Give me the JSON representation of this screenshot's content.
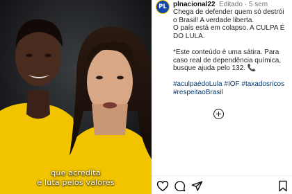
{
  "post": {
    "avatar_text": "PL",
    "username": "plnacional22",
    "edited": "Editado",
    "separator": "·",
    "age": "5 sem",
    "caption_line1": "Chega de defender quem só destrói o Brasil! A verdade liberta.",
    "caption_line2": "O país está em colapso. A CULPA É DO LULA.",
    "caption_line3": "*Este conteúdo é uma sátira. Para caso real de dependência química, busque ajuda pelo 132.",
    "phone_emoji": "📞",
    "hashtags": "#aculpaédoLula #IOF #taxadosricos #respeitaoBrasil"
  },
  "video": {
    "subtitle_line1": "que acredita",
    "subtitle_line2": "e luta pelos valores"
  },
  "icons": {
    "add_comment": "plus-circle-icon",
    "like": "heart-icon",
    "comment": "comment-icon",
    "share": "send-icon",
    "save": "bookmark-icon"
  },
  "colors": {
    "avatar_bg": "#1646a8",
    "avatar_ring": "#f4c400",
    "hashtag": "#00376b"
  }
}
